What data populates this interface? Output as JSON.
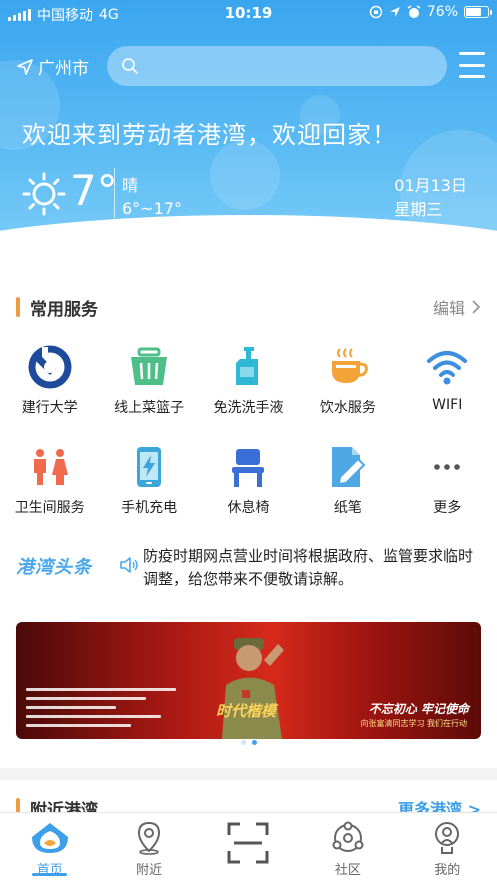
{
  "status_bar": {
    "carrier": "中国移动",
    "network": "4G",
    "time": "10:19",
    "battery": "76%",
    "battery_level": 0.76
  },
  "header": {
    "location": "广州市",
    "search_placeholder": "",
    "welcome": "欢迎来到劳动者港湾，欢迎回家！",
    "weather": {
      "temperature": "7°",
      "condition": "晴",
      "range": "6°~17°",
      "icon": "sun-icon"
    },
    "date": "01月13日",
    "weekday": "星期三"
  },
  "services": {
    "title": "常用服务",
    "edit_label": "编辑",
    "items": [
      {
        "label": "建行大学",
        "icon": "ccb-logo-icon",
        "color": "#1e4a9c"
      },
      {
        "label": "线上菜篮子",
        "icon": "basket-icon",
        "color": "#4fbf8a"
      },
      {
        "label": "免洗洗手液",
        "icon": "sanitizer-icon",
        "color": "#2fb7d6"
      },
      {
        "label": "饮水服务",
        "icon": "cup-icon",
        "color": "#f3a338"
      },
      {
        "label": "WIFI",
        "icon": "wifi-icon",
        "color": "#3d8fe0"
      },
      {
        "label": "卫生间服务",
        "icon": "restroom-icon",
        "color": "#f06a4d"
      },
      {
        "label": "手机充电",
        "icon": "phone-charge-icon",
        "color": "#3aa6d9"
      },
      {
        "label": "休息椅",
        "icon": "chair-icon",
        "color": "#3a6fd8"
      },
      {
        "label": "纸笔",
        "icon": "paper-pen-icon",
        "color": "#4fa8e4"
      },
      {
        "label": "更多",
        "icon": "more-icon",
        "color": "#555555"
      }
    ]
  },
  "news": {
    "brand": "港湾头条",
    "text": "防疫时期网点营业时间将根据政府、监管要求临时调整，给您带来不便敬请谅解。"
  },
  "banner": {
    "era_text": "时代楷模",
    "slogan": "不忘初心 牢记使命",
    "slogan_sub": "向张富清同志学习 我们在行动",
    "pages": 2,
    "active_page": 2
  },
  "section2": {
    "title": "附近港湾",
    "more_label": "更多港湾 >"
  },
  "tabbar": {
    "tabs": [
      {
        "label": "首页",
        "icon": "home-icon",
        "active": true
      },
      {
        "label": "附近",
        "icon": "location-pin-icon",
        "active": false
      },
      {
        "label": "",
        "icon": "scan-icon",
        "active": false
      },
      {
        "label": "社区",
        "icon": "community-icon",
        "active": false
      },
      {
        "label": "我的",
        "icon": "profile-icon",
        "active": false
      }
    ]
  },
  "colors": {
    "header_blue": "#3aa6ef",
    "accent_orange": "#f19a3f",
    "accent_blue": "#3d9fe8"
  }
}
